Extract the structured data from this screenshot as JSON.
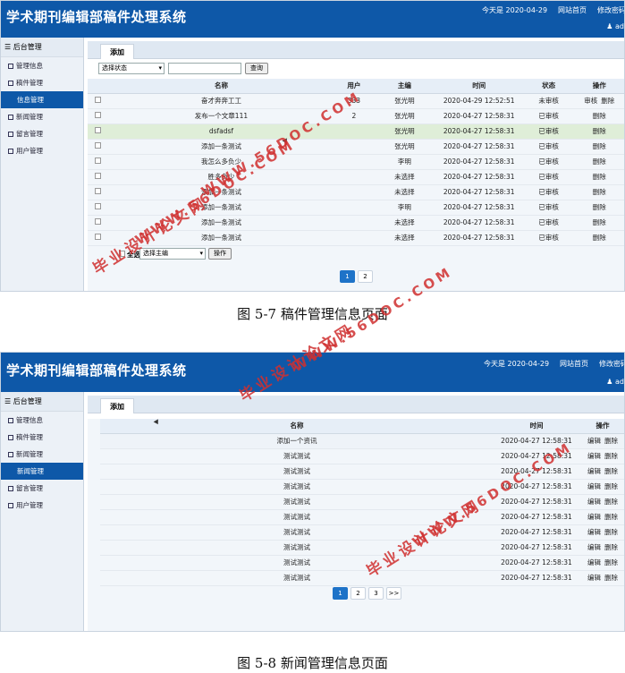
{
  "app_title": "学术期刊编辑部稿件处理系统",
  "header": {
    "date_text": "今天是 2020-04-29",
    "links": [
      "网站首页",
      "修改密码",
      "注销"
    ],
    "user": "ad"
  },
  "sidebar": {
    "title": "后台管理",
    "items": [
      {
        "label": "管理信息"
      },
      {
        "label": "稿件管理"
      },
      {
        "label": "新闻管理"
      },
      {
        "label": "留言管理"
      },
      {
        "label": "用户管理"
      }
    ]
  },
  "figure1": {
    "sidebar_items": [
      "管理信息",
      "稿件管理",
      "信息管理",
      "新闻管理",
      "留言管理",
      "用户管理"
    ],
    "tab": "添加",
    "filter": {
      "status_select": "选择状态",
      "search_button": "查询"
    },
    "columns": [
      "名称",
      "用户",
      "主编",
      "时间",
      "状态",
      "操作"
    ],
    "rows": [
      {
        "name": "奋才奔奔工工",
        "user": "333",
        "editor": "张光明",
        "time": "2020-04-29 12:52:51",
        "status": "未审核",
        "actions": [
          "审核",
          "删除"
        ]
      },
      {
        "name": "发布一个文章111",
        "user": "2",
        "editor": "张光明",
        "time": "2020-04-27 12:58:31",
        "status": "已审核",
        "actions": [
          "删除"
        ]
      },
      {
        "name": "dsfadsf",
        "user": "",
        "editor": "张光明",
        "time": "2020-04-27 12:58:31",
        "status": "已审核",
        "actions": [
          "删除"
        ]
      },
      {
        "name": "添加一条测试",
        "user": "",
        "editor": "张光明",
        "time": "2020-04-27 12:58:31",
        "status": "已审核",
        "actions": [
          "删除"
        ]
      },
      {
        "name": "我怎么多负少",
        "user": "",
        "editor": "李明",
        "time": "2020-04-27 12:58:31",
        "status": "已审核",
        "actions": [
          "删除"
        ]
      },
      {
        "name": "胜多负少",
        "user": "",
        "editor": "未选择",
        "time": "2020-04-27 12:58:31",
        "status": "已审核",
        "actions": [
          "删除"
        ]
      },
      {
        "name": "添加一条测试",
        "user": "",
        "editor": "未选择",
        "time": "2020-04-27 12:58:31",
        "status": "已审核",
        "actions": [
          "删除"
        ]
      },
      {
        "name": "添加一条测试",
        "user": "",
        "editor": "李明",
        "time": "2020-04-27 12:58:31",
        "status": "已审核",
        "actions": [
          "删除"
        ]
      },
      {
        "name": "添加一条测试",
        "user": "",
        "editor": "未选择",
        "time": "2020-04-27 12:58:31",
        "status": "已审核",
        "actions": [
          "删除"
        ]
      },
      {
        "name": "添加一条测试",
        "user": "",
        "editor": "未选择",
        "time": "2020-04-27 12:58:31",
        "status": "已审核",
        "actions": [
          "删除"
        ]
      }
    ],
    "bottom": {
      "select_all": "全选",
      "editor_select": "选择主编",
      "op_button": "操作"
    },
    "pages": [
      "1",
      "2"
    ],
    "caption": "图 5-7 稿件管理信息页面"
  },
  "figure2": {
    "sidebar_items": [
      "管理信息",
      "稿件管理",
      "新闻管理",
      "新闻管理",
      "留言管理",
      "用户管理"
    ],
    "tab": "添加",
    "columns": [
      "名称",
      "时间",
      "操作"
    ],
    "rows": [
      {
        "name": "添加一个资讯",
        "time": "2020-04-27 12:58:31",
        "actions": [
          "编辑",
          "删除"
        ]
      },
      {
        "name": "测试测试",
        "time": "2020-04-27 12:58:31",
        "actions": [
          "编辑",
          "删除"
        ]
      },
      {
        "name": "测试测试",
        "time": "2020-04-27 12:58:31",
        "actions": [
          "编辑",
          "删除"
        ]
      },
      {
        "name": "测试测试",
        "time": "2020-04-27 12:58:31",
        "actions": [
          "编辑",
          "删除"
        ]
      },
      {
        "name": "测试测试",
        "time": "2020-04-27 12:58:31",
        "actions": [
          "编辑",
          "删除"
        ]
      },
      {
        "name": "测试测试",
        "time": "2020-04-27 12:58:31",
        "actions": [
          "编辑",
          "删除"
        ]
      },
      {
        "name": "测试测试",
        "time": "2020-04-27 12:58:31",
        "actions": [
          "编辑",
          "删除"
        ]
      },
      {
        "name": "测试测试",
        "time": "2020-04-27 12:58:31",
        "actions": [
          "编辑",
          "删除"
        ]
      },
      {
        "name": "测试测试",
        "time": "2020-04-27 12:58:31",
        "actions": [
          "编辑",
          "删除"
        ]
      },
      {
        "name": "测试测试",
        "time": "2020-04-27 12:58:31",
        "actions": [
          "编辑",
          "删除"
        ]
      }
    ],
    "pages": [
      "1",
      "2",
      "3",
      ">>"
    ],
    "caption": "图 5-8 新闻管理信息页面"
  },
  "watermark": {
    "line1": "毕业设计论文网",
    "line2": "WWW.56DOC.COM"
  }
}
